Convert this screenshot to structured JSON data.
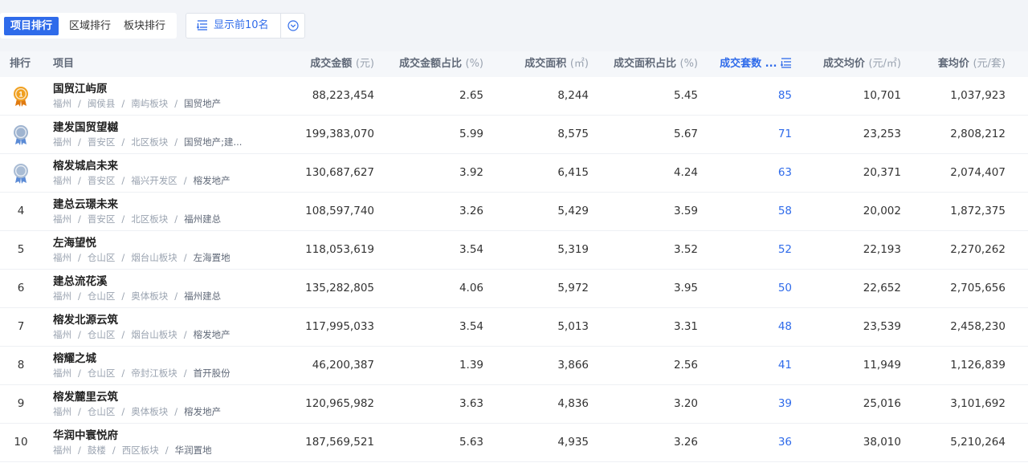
{
  "toolbar": {
    "tabs": [
      {
        "label": "项目排行",
        "active": true
      },
      {
        "label": "区域排行",
        "active": false
      },
      {
        "label": "板块排行",
        "active": false
      }
    ],
    "topn_label": "显示前10名",
    "topn_icon": "list-sort-icon",
    "dropdown_icon": "chevron-down-circle-icon"
  },
  "table": {
    "columns": {
      "rank": {
        "label": "排行"
      },
      "project": {
        "label": "项目"
      },
      "amount": {
        "label": "成交金额",
        "unit": "(元)"
      },
      "amount_pct": {
        "label": "成交金额占比",
        "unit": "(%)"
      },
      "area": {
        "label": "成交面积",
        "unit": "(㎡)"
      },
      "area_pct": {
        "label": "成交面积占比",
        "unit": "(%)"
      },
      "units": {
        "label": "成交套数 ..."
      },
      "avg_price": {
        "label": "成交均价",
        "unit": "(元/㎡)"
      },
      "avg_unit_price": {
        "label": "套均价",
        "unit": "(元/套)"
      }
    },
    "sorted_column": "units",
    "rows": [
      {
        "rank": "1",
        "medal": "gold",
        "name": "国贸江屿原",
        "city": "福州",
        "district": "闽侯县",
        "block": "南屿板块",
        "developer": "国贸地产",
        "amount": "88,223,454",
        "amount_pct": "2.65",
        "area": "8,244",
        "area_pct": "5.45",
        "units": "85",
        "avg_price": "10,701",
        "avg_unit_price": "1,037,923"
      },
      {
        "rank": "2",
        "medal": "silver",
        "name": "建发国贸望樾",
        "city": "福州",
        "district": "晋安区",
        "block": "北区板块",
        "developer": "国贸地产;建...",
        "amount": "199,383,070",
        "amount_pct": "5.99",
        "area": "8,575",
        "area_pct": "5.67",
        "units": "71",
        "avg_price": "23,253",
        "avg_unit_price": "2,808,212"
      },
      {
        "rank": "3",
        "medal": "bronze",
        "name": "榕发城启未来",
        "city": "福州",
        "district": "晋安区",
        "block": "福兴开发区",
        "developer": "榕发地产",
        "amount": "130,687,627",
        "amount_pct": "3.92",
        "area": "6,415",
        "area_pct": "4.24",
        "units": "63",
        "avg_price": "20,371",
        "avg_unit_price": "2,074,407"
      },
      {
        "rank": "4",
        "medal": "",
        "name": "建总云璟未来",
        "city": "福州",
        "district": "晋安区",
        "block": "北区板块",
        "developer": "福州建总",
        "amount": "108,597,740",
        "amount_pct": "3.26",
        "area": "5,429",
        "area_pct": "3.59",
        "units": "58",
        "avg_price": "20,002",
        "avg_unit_price": "1,872,375"
      },
      {
        "rank": "5",
        "medal": "",
        "name": "左海望悦",
        "city": "福州",
        "district": "仓山区",
        "block": "烟台山板块",
        "developer": "左海置地",
        "amount": "118,053,619",
        "amount_pct": "3.54",
        "area": "5,319",
        "area_pct": "3.52",
        "units": "52",
        "avg_price": "22,193",
        "avg_unit_price": "2,270,262"
      },
      {
        "rank": "6",
        "medal": "",
        "name": "建总流花溪",
        "city": "福州",
        "district": "仓山区",
        "block": "奥体板块",
        "developer": "福州建总",
        "amount": "135,282,805",
        "amount_pct": "4.06",
        "area": "5,972",
        "area_pct": "3.95",
        "units": "50",
        "avg_price": "22,652",
        "avg_unit_price": "2,705,656"
      },
      {
        "rank": "7",
        "medal": "",
        "name": "榕发北源云筑",
        "city": "福州",
        "district": "仓山区",
        "block": "烟台山板块",
        "developer": "榕发地产",
        "amount": "117,995,033",
        "amount_pct": "3.54",
        "area": "5,013",
        "area_pct": "3.31",
        "units": "48",
        "avg_price": "23,539",
        "avg_unit_price": "2,458,230"
      },
      {
        "rank": "8",
        "medal": "",
        "name": "榕耀之城",
        "city": "福州",
        "district": "仓山区",
        "block": "帝封江板块",
        "developer": "首开股份",
        "amount": "46,200,387",
        "amount_pct": "1.39",
        "area": "3,866",
        "area_pct": "2.56",
        "units": "41",
        "avg_price": "11,949",
        "avg_unit_price": "1,126,839"
      },
      {
        "rank": "9",
        "medal": "",
        "name": "榕发麓里云筑",
        "city": "福州",
        "district": "仓山区",
        "block": "奥体板块",
        "developer": "榕发地产",
        "amount": "120,965,982",
        "amount_pct": "3.63",
        "area": "4,836",
        "area_pct": "3.20",
        "units": "39",
        "avg_price": "25,016",
        "avg_unit_price": "3,101,692"
      },
      {
        "rank": "10",
        "medal": "",
        "name": "华润中寰悦府",
        "city": "福州",
        "district": "鼓楼",
        "block": "西区板块",
        "developer": "华润置地",
        "amount": "187,569,521",
        "amount_pct": "5.63",
        "area": "4,935",
        "area_pct": "3.26",
        "units": "36",
        "avg_price": "38,010",
        "avg_unit_price": "5,210,264"
      }
    ]
  },
  "colors": {
    "accent": "#2f6bea",
    "gold": "#f0a020",
    "silver": "#9fb4d0",
    "bronze": "#a9bcd4"
  }
}
